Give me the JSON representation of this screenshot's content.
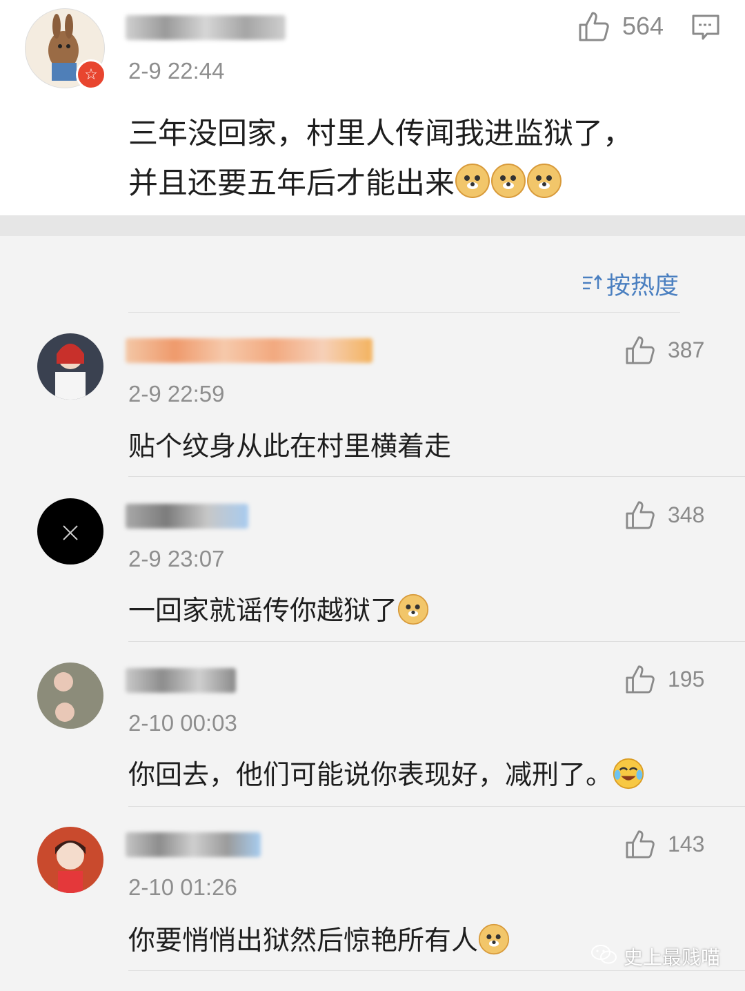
{
  "original_post": {
    "username_placeholder": "blurred",
    "time": "2-9 22:44",
    "likes": "564",
    "text_line1": "三年没回家，村里人传闻我进监狱了，",
    "text_line2": "并且还要五年后才能出来",
    "emoji_count": 3
  },
  "sort_label": "按热度",
  "comments": [
    {
      "time": "2-9 22:59",
      "likes": "387",
      "text": "贴个纹身从此在村里横着走"
    },
    {
      "time": "2-9 23:07",
      "likes": "348",
      "text": "一回家就谣传你越狱了"
    },
    {
      "time": "2-10 00:03",
      "likes": "195",
      "text": "你回去，他们可能说你表现好，减刑了。"
    },
    {
      "time": "2-10 01:26",
      "likes": "143",
      "text": "你要悄悄出狱然后惊艳所有人"
    }
  ],
  "watermark": "史上最贱喵",
  "colors": {
    "accent": "#4a7fc0",
    "verified_badge": "#e8452f"
  }
}
